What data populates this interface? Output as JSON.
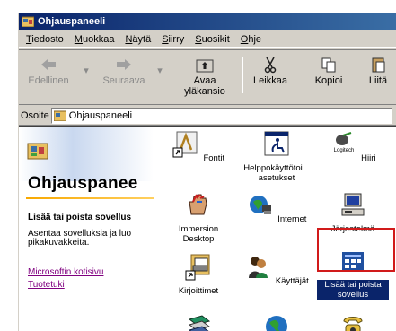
{
  "window": {
    "title": "Ohjauspaneeli"
  },
  "menu": [
    {
      "label": "Tiedosto",
      "key": "T"
    },
    {
      "label": "Muokkaa",
      "key": "M"
    },
    {
      "label": "Näytä",
      "key": "N"
    },
    {
      "label": "Siirry",
      "key": "S"
    },
    {
      "label": "Suosikit",
      "key": "S"
    },
    {
      "label": "Ohje",
      "key": "O"
    }
  ],
  "toolbar": {
    "back": "Edellinen",
    "forward": "Seuraava",
    "up_line1": "Avaa",
    "up_line2": "yläkansio",
    "cut": "Leikkaa",
    "copy": "Kopioi",
    "paste": "Liitä"
  },
  "address": {
    "label": "Osoite",
    "value": "Ohjauspaneeli"
  },
  "leftpane": {
    "title": "Ohjauspanee",
    "heading": "Lisää tai poista sovellus",
    "description": "Asentaa sovelluksia ja luo pikakuvakkeita.",
    "link1": "Microsoftin kotisivu",
    "link2": "Tuotetuki"
  },
  "items": [
    {
      "label": "Fontit",
      "icon": "fonts-icon"
    },
    {
      "label": "Helppokäyttötoi... asetukset",
      "icon": "accessibility-icon"
    },
    {
      "label": "Hiiri",
      "icon": "mouse-icon"
    },
    {
      "label": "Immersion Desktop",
      "icon": "immersion-icon"
    },
    {
      "label": "Internet",
      "icon": "internet-icon"
    },
    {
      "label": "Järjestelmä",
      "icon": "system-icon"
    },
    {
      "label": "Kirjoittimet",
      "icon": "printers-icon"
    },
    {
      "label": "Käyttäjät",
      "icon": "users-icon"
    },
    {
      "label": "Lisää tai poista sovellus",
      "icon": "add-remove-programs-icon"
    }
  ],
  "items_partial_row": [
    {
      "icon": "books-icon"
    },
    {
      "icon": "globe-icon"
    },
    {
      "icon": "phone-icon"
    }
  ],
  "logitech_caption": "Logitech",
  "colors": {
    "titlebar": "#0a246a",
    "selection": "#0a246a",
    "highlight_frame": "#d11a1a",
    "link_visited": "#800080"
  }
}
